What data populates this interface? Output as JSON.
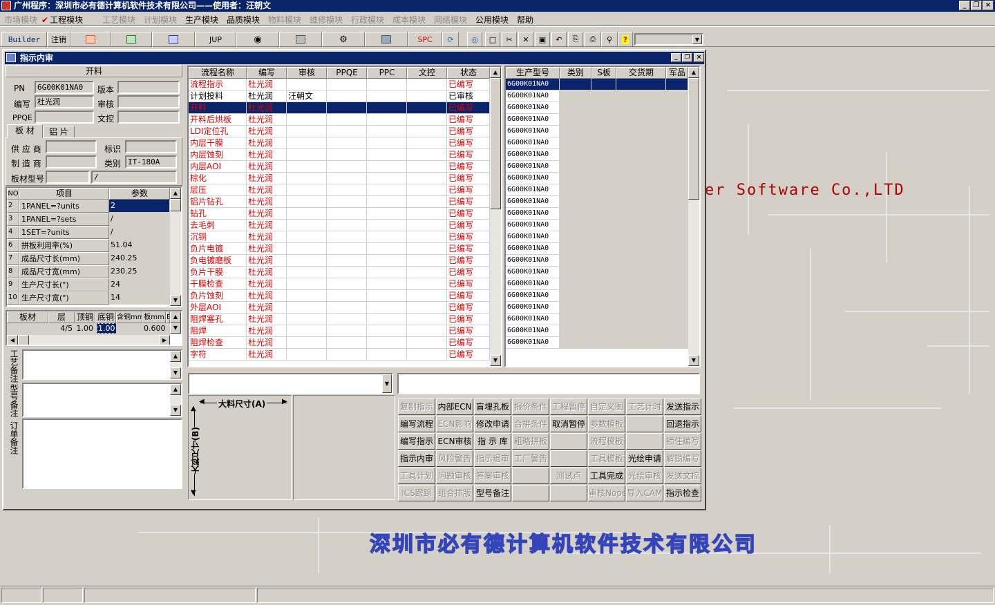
{
  "app": {
    "title": "广州程序：深圳市必有德计算机软件技术有限公司——使用者：汪朝文"
  },
  "menu": [
    {
      "label": "市场模块",
      "enabled": false
    },
    {
      "label": "工程模块",
      "enabled": true,
      "checked": true
    },
    {
      "label": "工艺模块",
      "enabled": false
    },
    {
      "label": "计划模块",
      "enabled": false
    },
    {
      "label": "生产模块",
      "enabled": true
    },
    {
      "label": "品质模块",
      "enabled": true
    },
    {
      "label": "物料模块",
      "enabled": false
    },
    {
      "label": "维修模块",
      "enabled": false
    },
    {
      "label": "行政模块",
      "enabled": false
    },
    {
      "label": "成本模块",
      "enabled": false
    },
    {
      "label": "网络模块",
      "enabled": false
    },
    {
      "label": "公用模块",
      "enabled": true
    },
    {
      "label": "帮助",
      "enabled": true
    }
  ],
  "toolbar": {
    "builder": "Builder",
    "logout": "注销",
    "jup": "JUP",
    "spc": "SPC"
  },
  "desktop": {
    "bg_text": "er Software Co.,LTD",
    "company": "深圳市必有德计算机软件技术有限公司"
  },
  "child": {
    "title": "指示内审"
  },
  "left": {
    "section": "开料",
    "pn_label": "PN",
    "pn_value": "6G00K01NA0",
    "version_label": "版本",
    "version_value": "",
    "author_label": "编写",
    "author_value": "杜光润",
    "review_label": "审核",
    "review_value": "",
    "ppqe_label": "PPQE",
    "ppqe_value": "",
    "doccheck_label": "文控",
    "doccheck_value": "",
    "tabs": [
      "板 材",
      "铝 片"
    ],
    "supplier_label": "供 应 商",
    "supplier_value": "",
    "mark_label": "标识",
    "mark_value": "",
    "maker_label": "制 造 商",
    "maker_value": "",
    "class_label": "类别",
    "class_value": "IT-180A",
    "model_label": "板材型号",
    "model_value": "",
    "model_value2": "/",
    "params": {
      "headers": [
        "NO",
        "项目",
        "参数"
      ],
      "rows": [
        {
          "no": "2",
          "item": "1PANEL=?units",
          "value": "2"
        },
        {
          "no": "3",
          "item": "1PANEL=?sets",
          "value": "/"
        },
        {
          "no": "4",
          "item": "1SET=?units",
          "value": "/"
        },
        {
          "no": "6",
          "item": "拼板利用率(%)",
          "value": "51.04"
        },
        {
          "no": "7",
          "item": "成品尺寸长(mm)",
          "value": "240.25"
        },
        {
          "no": "8",
          "item": "成品尺寸宽(mm)",
          "value": "230.25"
        },
        {
          "no": "9",
          "item": "生产尺寸长(\")",
          "value": "24"
        },
        {
          "no": "10",
          "item": "生产尺寸宽(\")",
          "value": "14"
        }
      ]
    },
    "material": {
      "headers": [
        "板材",
        "层",
        "顶铜",
        "底铜",
        "含铜mm",
        "板mm",
        "E"
      ],
      "row": [
        "",
        "4/5",
        "1.00",
        "1.00",
        "",
        "0.600",
        ""
      ]
    },
    "remarks": [
      "工艺备注",
      "型号备注",
      "订单备注"
    ]
  },
  "flow": {
    "headers": [
      "流程名称",
      "编写",
      "审核",
      "PPQE",
      "PPC",
      "文控",
      "状态"
    ],
    "rows": [
      {
        "name": "流程指示",
        "author": "杜光润",
        "reviewer": "",
        "status": "已编写"
      },
      {
        "name": "计划投料",
        "author": "杜光润",
        "reviewer": "汪朝文",
        "status": "已审核"
      },
      {
        "name": "开料",
        "author": "杜光润",
        "reviewer": "",
        "status": "已编写"
      },
      {
        "name": "开料后烘板",
        "author": "杜光润",
        "reviewer": "",
        "status": "已编写"
      },
      {
        "name": "LDI定位孔",
        "author": "杜光润",
        "reviewer": "",
        "status": "已编写"
      },
      {
        "name": "内层干膜",
        "author": "杜光润",
        "reviewer": "",
        "status": "已编写"
      },
      {
        "name": "内层蚀刻",
        "author": "杜光润",
        "reviewer": "",
        "status": "已编写"
      },
      {
        "name": "内层AOI",
        "author": "杜光润",
        "reviewer": "",
        "status": "已编写"
      },
      {
        "name": "棕化",
        "author": "杜光润",
        "reviewer": "",
        "status": "已编写"
      },
      {
        "name": "层压",
        "author": "杜光润",
        "reviewer": "",
        "status": "已编写"
      },
      {
        "name": "铝片钻孔",
        "author": "杜光润",
        "reviewer": "",
        "status": "已编写"
      },
      {
        "name": "钻孔",
        "author": "杜光润",
        "reviewer": "",
        "status": "已编写"
      },
      {
        "name": "去毛刺",
        "author": "杜光润",
        "reviewer": "",
        "status": "已编写"
      },
      {
        "name": "沉铜",
        "author": "杜光润",
        "reviewer": "",
        "status": "已编写"
      },
      {
        "name": "负片电镀",
        "author": "杜光润",
        "reviewer": "",
        "status": "已编写"
      },
      {
        "name": "负电镀磨板",
        "author": "杜光润",
        "reviewer": "",
        "status": "已编写"
      },
      {
        "name": "负片干膜",
        "author": "杜光润",
        "reviewer": "",
        "status": "已编写"
      },
      {
        "name": "干膜检查",
        "author": "杜光润",
        "reviewer": "",
        "status": "已编写"
      },
      {
        "name": "负片蚀刻",
        "author": "杜光润",
        "reviewer": "",
        "status": "已编写"
      },
      {
        "name": "外层AOI",
        "author": "杜光润",
        "reviewer": "",
        "status": "已编写"
      },
      {
        "name": "阻焊塞孔",
        "author": "杜光润",
        "reviewer": "",
        "status": "已编写"
      },
      {
        "name": "阻焊",
        "author": "杜光润",
        "reviewer": "",
        "status": "已编写"
      },
      {
        "name": "阻焊检查",
        "author": "杜光润",
        "reviewer": "",
        "status": "已编写"
      },
      {
        "name": "字符",
        "author": "杜光润",
        "reviewer": "",
        "status": "已编写"
      }
    ]
  },
  "models": {
    "headers": [
      "生产型号",
      "类别",
      "S板",
      "交货期",
      "军品"
    ],
    "rows": [
      "6G00K01NA0",
      "6G00K01NA0",
      "6G00K01NA0",
      "6G00K01NA0",
      "6G00K01NA0",
      "6G00K01NA0",
      "6G00K01NA0",
      "6G00K01NA0",
      "6G00K01NA0",
      "6G00K01NA0",
      "6G00K01NA0",
      "6G00K01NA0",
      "6G00K01NA0",
      "6G00K01NA0",
      "6G00K01NA0",
      "6G00K01NA0",
      "6G00K01NA0",
      "6G00K01NA0",
      "6G00K01NA0",
      "6G00K01NA0",
      "6G00K01NA0",
      "6G00K01NA0",
      "6G00K01NA0"
    ]
  },
  "dims": {
    "a": "大料尺寸(A)",
    "b": "大料尺寸(B)"
  },
  "actions": [
    [
      {
        "l": "复制指示",
        "e": false
      },
      {
        "l": "内部ECN",
        "e": true
      },
      {
        "l": "盲埋孔板",
        "e": true
      },
      {
        "l": "报价条件",
        "e": false
      },
      {
        "l": "工程暂停",
        "e": false
      },
      {
        "l": "自定义图",
        "e": false
      },
      {
        "l": "工艺计时",
        "e": false
      },
      {
        "l": "发送指示",
        "e": true
      }
    ],
    [
      {
        "l": "编写流程",
        "e": true
      },
      {
        "l": "ECN影响",
        "e": false
      },
      {
        "l": "修改申请",
        "e": true
      },
      {
        "l": "合拼条件",
        "e": false
      },
      {
        "l": "取消暂停",
        "e": true
      },
      {
        "l": "参数模板",
        "e": false
      },
      {
        "l": "",
        "e": false
      },
      {
        "l": "回退指示",
        "e": true
      }
    ],
    [
      {
        "l": "编写指示",
        "e": true
      },
      {
        "l": "ECN审核",
        "e": true
      },
      {
        "l": "指 示 库",
        "e": true
      },
      {
        "l": "粗略拼板",
        "e": false
      },
      {
        "l": "",
        "e": false
      },
      {
        "l": "流程模板",
        "e": false
      },
      {
        "l": "",
        "e": false
      },
      {
        "l": "锁住编写",
        "e": false
      }
    ],
    [
      {
        "l": "指示内审",
        "e": true
      },
      {
        "l": "风险警告",
        "e": false
      },
      {
        "l": "指示退审",
        "e": false
      },
      {
        "l": "工厂警告",
        "e": false
      },
      {
        "l": "",
        "e": false
      },
      {
        "l": "工具模板",
        "e": false
      },
      {
        "l": "光绘申请",
        "e": true
      },
      {
        "l": "解锁编写",
        "e": false
      }
    ],
    [
      {
        "l": "工具计划",
        "e": false
      },
      {
        "l": "问题审核",
        "e": false
      },
      {
        "l": "答案审核",
        "e": false
      },
      {
        "l": "",
        "e": false
      },
      {
        "l": "测试点",
        "e": false
      },
      {
        "l": "工具完成",
        "e": true
      },
      {
        "l": "光绘审核",
        "e": false
      },
      {
        "l": "发送文控",
        "e": false
      }
    ],
    [
      {
        "l": "ICS跟踪",
        "e": false
      },
      {
        "l": "组合排版",
        "e": false
      },
      {
        "l": "型号备注",
        "e": true
      },
      {
        "l": "",
        "e": false
      },
      {
        "l": "",
        "e": false
      },
      {
        "l": "审核Nope",
        "e": false
      },
      {
        "l": "导入CAM",
        "e": false
      },
      {
        "l": "指示检查",
        "e": true
      }
    ]
  ]
}
